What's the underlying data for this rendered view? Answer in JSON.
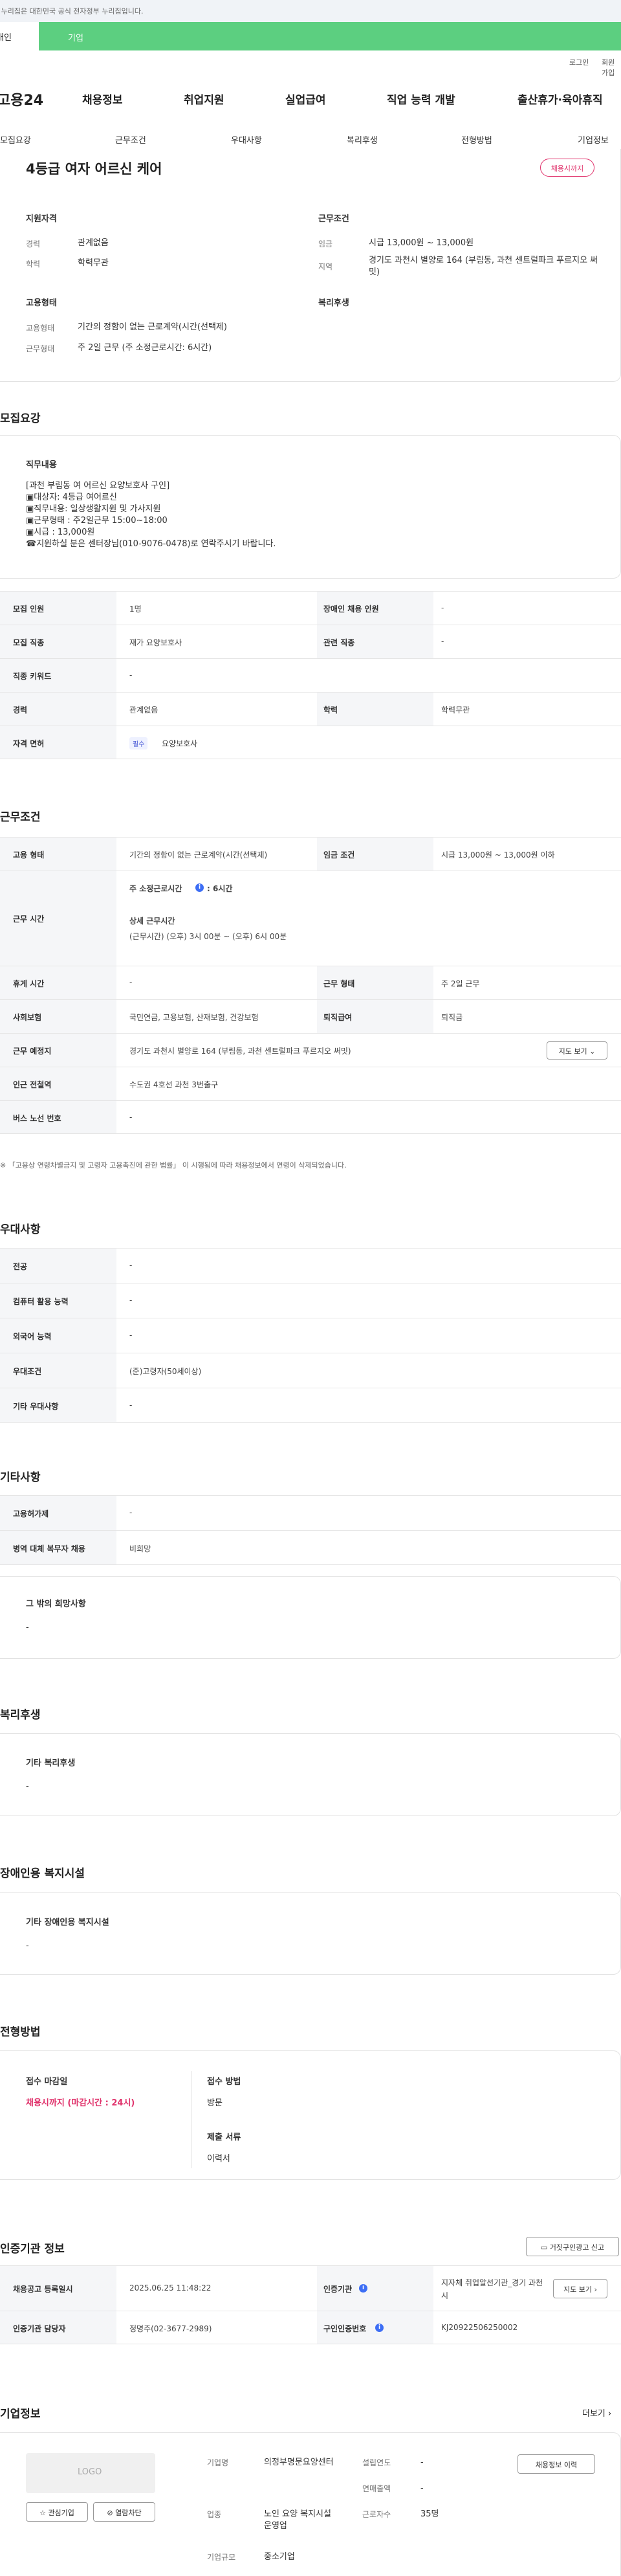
{
  "gov_banner": "이 누리집은 대한민국 공식 전자정부 누리집입니다.",
  "tabs": {
    "personal": "개인",
    "company": "기업"
  },
  "util": {
    "login": "로그인",
    "join": "회원가입"
  },
  "logo": "고용24",
  "gnb": [
    "채용정보",
    "취업지원",
    "실업급여",
    "직업 능력 개발",
    "출산휴가·육아휴직"
  ],
  "subnav": [
    "모집요강",
    "근무조건",
    "우대사항",
    "복리후생",
    "전형방법",
    "기업정보"
  ],
  "summary": {
    "title": "4등급 여자 어르신 케어",
    "badge": "채용시까지",
    "qualification_h": "지원자격",
    "career_label": "경력",
    "career_value": "관계없음",
    "edu_label": "학력",
    "edu_value": "학력무관",
    "employment_h": "고용형태",
    "emp_type_label": "고용형태",
    "emp_type_value": "기간의 정함이 없는 근로계약(시간(선택제)",
    "work_type_label": "근무형태",
    "work_type_value": "주 2일 근무 (주 소정근로시간: 6시간)",
    "condition_h": "근무조건",
    "wage_label": "임금",
    "wage_value": "시급 13,000원 ~ 13,000원",
    "region_label": "지역",
    "region_value": "경기도 과천시 별양로 164 (부림동, 과천 센트럴파크 푸르지오 써밋)",
    "welfare_h": "복리후생"
  },
  "recruit": {
    "heading": "모집요강",
    "duty_h": "직무내용",
    "duty_lines": [
      "[과천 부림동 여 어르신 요양보호사 구인]",
      "▣대상자: 4등급 여어르신",
      "▣직무내용: 일상생활지원 및 가사지원",
      "▣근무형태 : 주2일근무 15:00~18:00",
      "▣시급 : 13,000원",
      "☎지원하실 분은 센터장님(010-9076-0478)로 연락주시기 바랍니다."
    ],
    "headcount_l": "모집 인원",
    "headcount_v": "1명",
    "disabled_l": "장애인 채용 인원",
    "disabled_v": "-",
    "job_l": "모집 직종",
    "job_v": "재가 요양보호사",
    "related_l": "관련 직종",
    "related_v": "-",
    "keyword_l": "직종 키워드",
    "keyword_v": "-",
    "career_l": "경력",
    "career_v": "관계없음",
    "edu_l": "학력",
    "edu_v": "학력무관",
    "license_l": "자격 면허",
    "license_chip": "필수",
    "license_v": "요양보호사"
  },
  "conditions": {
    "heading": "근무조건",
    "emp_l": "고용 형태",
    "emp_v": "기간의 정함이 없는 근로계약(시간(선택제)",
    "wage_l": "임금 조건",
    "wage_v": "시급 13,000원 ~ 13,000원 이하",
    "hours_l": "근무 시간",
    "hours_main": "주 소정근로시간",
    "hours_main_v": ": 6시간",
    "hours_detail_h": "상세 근무시간",
    "hours_detail_v": "(근무시간) (오후) 3시 00분 ~ (오후) 6시 00분",
    "rest_l": "휴게 시간",
    "rest_v": "-",
    "form_l": "근무 형태",
    "form_v": "주 2일 근무",
    "insurance_l": "사회보험",
    "insurance_v": "국민연금, 고용보험, 산재보험, 건강보험",
    "severance_l": "퇴직급여",
    "severance_v": "퇴직금",
    "place_l": "근무 예정지",
    "place_v": "경기도 과천시 별양로 164 (부림동, 과천 센트럴파크 푸르지오 써밋)",
    "map_btn": "지도 보기",
    "subway_l": "인근 전철역",
    "subway_v": "수도권 4호선 과천 3번출구",
    "bus_l": "버스 노선 번호",
    "bus_v": "-",
    "notice": "※ 「고용상 연령차별금지 및 고령자 고용촉진에 관한 법률」 이 시행됨에 따라 채용정보에서 연령이 삭제되었습니다."
  },
  "preference": {
    "heading": "우대사항",
    "rows": [
      {
        "l": "전공",
        "v": "-"
      },
      {
        "l": "컴퓨터 활용 능력",
        "v": "-"
      },
      {
        "l": "외국어 능력",
        "v": "-"
      },
      {
        "l": "우대조건",
        "v": "(준)고령자(50세이상)"
      },
      {
        "l": "기타 우대사항",
        "v": "-"
      }
    ]
  },
  "etc": {
    "heading": "기타사항",
    "subsidy_l": "고용허가제",
    "subsidy_v": "-",
    "military_l": "병역 대체 복무자 채용",
    "military_v": "비희망",
    "other_h": "그 밖의 희망사항",
    "other_v": "-"
  },
  "welfare": {
    "heading": "복리후생",
    "box_h": "기타 복리후생",
    "box_v": "-"
  },
  "disability": {
    "heading": "장애인용 복지시설",
    "box_h": "기타 장애인용 복지시설",
    "box_v": "-"
  },
  "process": {
    "heading": "전형방법",
    "deadline_h": "접수 마감일",
    "deadline_v": "채용시까지 (마감시간 : 24시)",
    "method_h": "접수 방법",
    "method_v": "방문",
    "docs_h": "제출 서류",
    "docs_v": "이력서"
  },
  "cert": {
    "heading": "인증기관 정보",
    "report_btn": "거짓구인광고 신고",
    "reg_l": "채용공고 등록일시",
    "reg_v": "2025.06.25 11:48:22",
    "org_l": "인증기관",
    "org_v": "지자체 취업알선기관_경기 과천시",
    "map_btn": "지도 보기",
    "manager_l": "인증기관 담당자",
    "manager_v": "정명주(02-3677-2989)",
    "num_l": "구인인증번호",
    "num_v": "KJ20922506250002"
  },
  "company": {
    "heading": "기업정보",
    "more": "더보기",
    "logo_text": "LOGO",
    "fav_btn": "관심기업",
    "block_btn": "열람차단",
    "name_l": "기업명",
    "name_v": "의정부명문요양센터",
    "industry_l": "업종",
    "industry_v": "노인 요양 복지시설 운영업",
    "size_l": "기업규모",
    "size_v": "중소기업",
    "founded_l": "설립연도",
    "founded_v": "-",
    "sales_l": "연매출액",
    "sales_v": "-",
    "employees_l": "근로자수",
    "employees_v": "35명",
    "history_btn": "채용정보 이력"
  },
  "colors": {
    "accent_green": "#5ccf80",
    "badge_pink": "#e0336c",
    "info_blue": "#3d6ef5"
  }
}
